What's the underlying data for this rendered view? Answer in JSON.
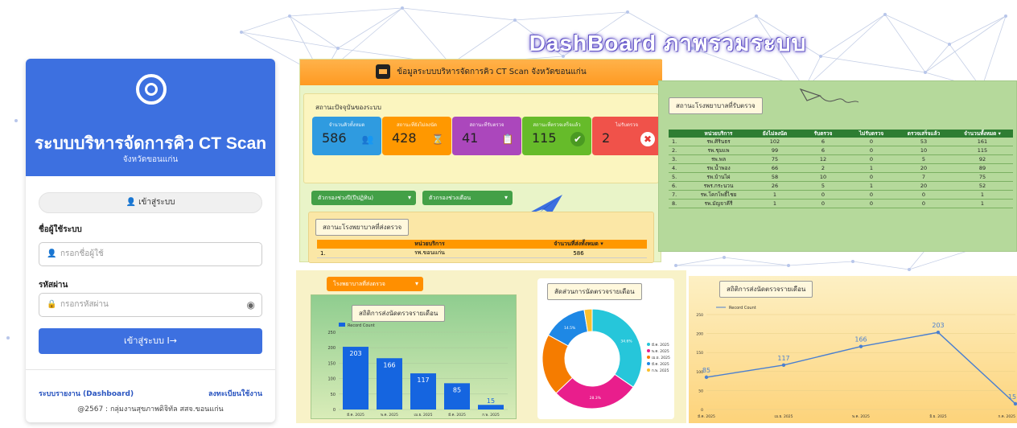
{
  "title": "DashBoard ภาพรวมระบบ",
  "login": {
    "title": "ระบบบริหารจัดการคิว CT Scan",
    "subtitle": "จังหวัดขอนแก่น",
    "tab": "เข้าสู่ระบบ",
    "user_label": "ชื่อผู้ใช้ระบบ",
    "user_placeholder": "กรอกชื่อผู้ใช้",
    "pass_label": "รหัสผ่าน",
    "pass_placeholder": "กรอกรหัสผ่าน",
    "submit": "เข้าสู่ระบบ  I→",
    "link_dashboard": "ระบบรายงาน (Dashboard)",
    "link_register": "ลงทะเบียนใช้งาน",
    "copyright": "@2567 : กลุ่มงานสุขภาพดิจิทัล สสจ.ขอนแก่น"
  },
  "panel1": {
    "header": "ข้อมูลระบบบริหารจัดการคิว CT Scan จังหวัดขอนแก่น",
    "status_title": "สถานะปัจจุบันของระบบ",
    "cards": [
      {
        "label": "จำนวนคิวทั้งหมด",
        "value": "586",
        "color": "#2f9be0",
        "icon": "people-icon"
      },
      {
        "label": "สถานะที่ยังไม่ลงนัด",
        "value": "428",
        "color": "#ff9800",
        "icon": "hourglass-icon"
      },
      {
        "label": "สถานะที่รับตรวจ",
        "value": "41",
        "color": "#ab47bc",
        "icon": "clipboard-icon"
      },
      {
        "label": "สถานะที่ตรวจเสร็จแล้ว",
        "value": "115",
        "color": "#66bb2a",
        "icon": "check-icon"
      },
      {
        "label": "ไม่รับตรวจ",
        "value": "2",
        "color": "#f0524a",
        "icon": "cancel-icon"
      }
    ],
    "filter1": "ตัวกรองช่วงปี(ปีปฏิทิน)",
    "filter2": "ตัวกรองช่วงเดือน",
    "send_title": "สถานะโรงพยาบาลที่ส่งตรวจ",
    "send_headers": [
      "",
      "หน่วยบริการ",
      "จำนวนที่ส่งทั้งหมด ▾"
    ],
    "send_rows": [
      [
        "1.",
        "รพ.ขอนแก่น",
        "586"
      ]
    ]
  },
  "panel2": {
    "title": "สถานะโรงพยาบาลที่รับตรวจ",
    "headers": [
      "",
      "หน่วยบริการ",
      "ยังไม่ลงนัด",
      "รับตรวจ",
      "ไม่รับตรวจ",
      "ตรวจเสร็จแล้ว",
      "จำนวนทั้งหมด ▾"
    ],
    "rows": [
      [
        "1.",
        "รพ.ศิรินธร",
        "102",
        "6",
        "0",
        "53",
        "161"
      ],
      [
        "2.",
        "รพ.ชุมแพ",
        "99",
        "6",
        "0",
        "10",
        "115"
      ],
      [
        "3.",
        "รพ.พล",
        "75",
        "12",
        "0",
        "5",
        "92"
      ],
      [
        "4.",
        "รพ.น้ำพอง",
        "66",
        "2",
        "1",
        "20",
        "89"
      ],
      [
        "5.",
        "รพ.บ้านไผ่",
        "58",
        "10",
        "0",
        "7",
        "75"
      ],
      [
        "6.",
        "รพร.กระนวน",
        "26",
        "5",
        "1",
        "20",
        "52"
      ],
      [
        "7.",
        "รพ.โคกโพธิ์ไชย",
        "1",
        "0",
        "0",
        "0",
        "1"
      ],
      [
        "8.",
        "รพ.มัญจาคีรี",
        "1",
        "0",
        "0",
        "0",
        "1"
      ]
    ]
  },
  "panel3": {
    "filter": "โรงพยาบาลที่ส่งตรวจ",
    "bar_title": "สถิติการส่งนัดตรวจรายเดือน",
    "pie_title": "สัดส่วนการนัดตรวจรายเดือน"
  },
  "panel4": {
    "title": "สถิติการส่งนัดตรวจรายเดือน"
  },
  "chart_data": [
    {
      "type": "bar",
      "title": "สถิติการส่งนัดตรวจรายเดือน",
      "legend": "Record Count",
      "categories": [
        "มี.ค. 2025",
        "พ.ค. 2025",
        "เม.ย. 2025",
        "มี.ค. 2025",
        "ก.พ. 2025"
      ],
      "values": [
        203,
        166,
        117,
        85,
        15
      ],
      "ylim": [
        0,
        250
      ],
      "yticks": [
        0,
        50,
        100,
        150,
        200,
        250
      ]
    },
    {
      "type": "pie",
      "title": "สัดส่วนการนัดตรวจรายเดือน",
      "labels": [
        "มี.ค. 2025",
        "พ.ค. 2025",
        "เม.ย. 2025",
        "มี.ค. 2025",
        "ก.พ. 2025"
      ],
      "values": [
        34.6,
        28.3,
        20,
        14.5,
        2.6
      ],
      "colors": [
        "#26c6da",
        "#e91e8c",
        "#f57c00",
        "#1e88e5",
        "#fbc02d"
      ],
      "slice_labels": [
        "34.6%",
        "28.3%",
        "",
        "14.5%",
        ""
      ]
    },
    {
      "type": "line",
      "title": "สถิติการส่งนัดตรวจรายเดือน",
      "legend": "Record Count",
      "categories": [
        "มี.ค. 2025",
        "เม.ย. 2025",
        "พ.ค. 2025",
        "มิ.ย. 2025",
        "ก.ค. 2025"
      ],
      "values": [
        85,
        117,
        166,
        203,
        15
      ],
      "point_labels": [
        "85",
        "117",
        "166",
        "203",
        "15"
      ],
      "ylim": [
        0,
        250
      ],
      "yticks": [
        0,
        50,
        100,
        150,
        200,
        250
      ]
    }
  ],
  "colors": {
    "primary": "#3d70e0",
    "orange": "#ff9800",
    "green": "#2e7d32"
  }
}
